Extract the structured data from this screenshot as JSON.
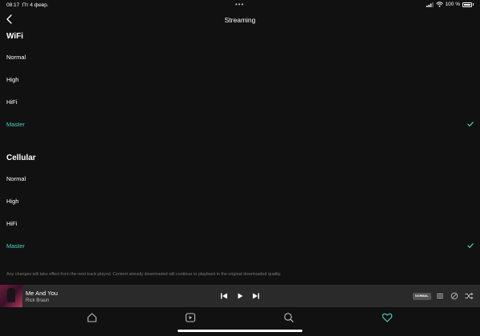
{
  "status_bar": {
    "time": "08:17",
    "date": "Пт 4 февр.",
    "battery": "100 %"
  },
  "header": {
    "title": "Streaming",
    "back_icon": "chevron-left-icon"
  },
  "wifi": {
    "title": "WiFi",
    "options": [
      {
        "label": "Normal",
        "selected": false
      },
      {
        "label": "High",
        "selected": false
      },
      {
        "label": "HiFi",
        "selected": false
      },
      {
        "label": "Master",
        "selected": true
      }
    ]
  },
  "cellular": {
    "title": "Cellular",
    "options": [
      {
        "label": "Normal",
        "selected": false
      },
      {
        "label": "High",
        "selected": false
      },
      {
        "label": "HiFi",
        "selected": false
      },
      {
        "label": "Master",
        "selected": true
      }
    ]
  },
  "note": "Any changes will take effect from the next track played. Content already downloaded will continue to playback in the original downloaded quality.",
  "player": {
    "track_title": "Me And You",
    "artist": "Rick Braun",
    "quality_badge": "NORMAL"
  },
  "tabs": [
    "home-icon",
    "videos-icon",
    "search-icon",
    "my-collection-heart-icon"
  ],
  "colors": {
    "background": "#111111",
    "accent": "#4cd2c0",
    "player_background": "#2a2a2a"
  }
}
